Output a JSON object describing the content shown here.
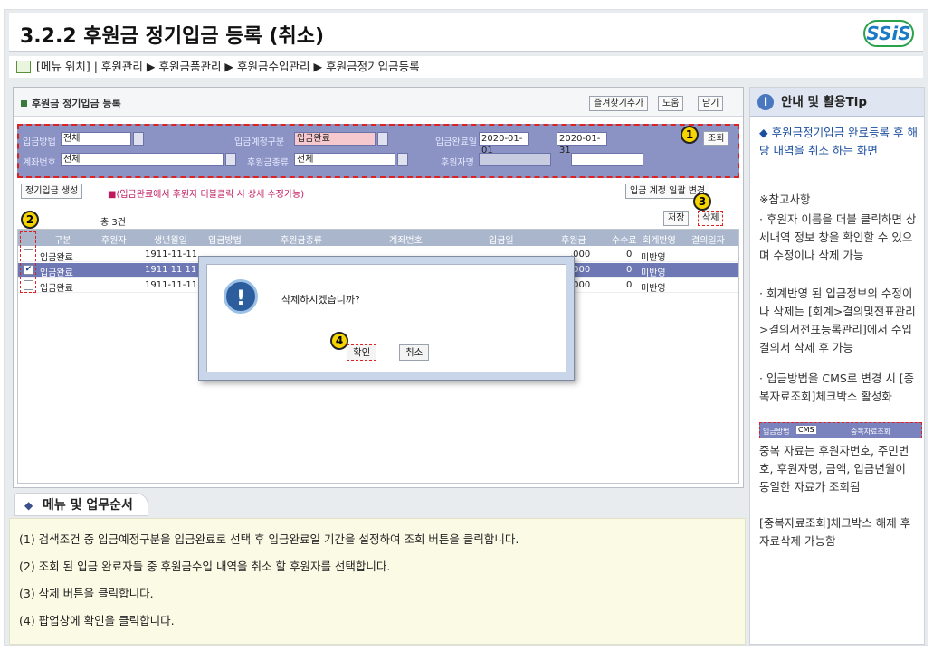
{
  "page_title": "3.2.2 후원금 정기입금 등록 (취소)",
  "logo": "SSiS",
  "breadcrumb": "[메뉴 위치] | 후원관리 ▶ 후원금품관리 ▶ 후원금수입관리 ▶ 후원금정기입금등록",
  "window": {
    "title": "후원금 정기입금 등록",
    "buttons": [
      "즐겨찾기추가",
      "도움",
      "닫기"
    ]
  },
  "search": {
    "method_label": "입금방법",
    "method_value": "전체",
    "type_label": "입금예정구분",
    "type_value": "입금완료",
    "date_label": "입금완료일",
    "date_from": "2020-01-01",
    "date_to": "2020-01-31",
    "account_label": "계좌번호",
    "account_value": "전체",
    "kind_label": "후원금종류",
    "kind_value": "전체",
    "donor_label": "후원자명",
    "search_btn": "조회"
  },
  "toolbar": {
    "create_btn": "정기입금 생성",
    "notice": "■(입금완료에서 후원자 더블클릭 시 상세 수정가능)",
    "batch_btn": "입금 계정 일괄 변경",
    "save_btn": "저장",
    "delete_btn": "삭제",
    "total": "총 3건"
  },
  "grid": {
    "headers": [
      "구분",
      "후원자",
      "생년월일",
      "입금방법",
      "후원금종류",
      "계좌번호",
      "입금일",
      "후원금",
      "수수료",
      "회계반영",
      "결의일자"
    ],
    "rows": [
      {
        "type": "입금완료",
        "birth": "1911-11-11",
        "amount": ",000",
        "fee": "0",
        "acct": "미반영",
        "checked": false
      },
      {
        "type": "입금완료",
        "birth": "1911 11 11",
        "amount": ",000",
        "fee": "0",
        "acct": "미반영",
        "checked": true
      },
      {
        "type": "입금완료",
        "birth": "1911-11-11",
        "amount": ",000",
        "fee": "0",
        "acct": "미반영",
        "checked": false
      }
    ]
  },
  "dialog": {
    "message": "삭제하시겠습니까?",
    "ok": "확인",
    "cancel": "취소"
  },
  "markers": [
    "1",
    "2",
    "3",
    "4"
  ],
  "menu": {
    "title": "메뉴 및 업무순서",
    "steps": [
      "(1) 검색조건 중 입금예정구분을 입금완료로 선택 후 입금완료일 기간을 설정하여 조회 버튼을 클릭합니다.",
      "(2) 조회 된 입금 완료자들 중 후원금수입 내역을 취소 할 후원자를 선택합니다.",
      "(3) 삭제 버튼을 클릭합니다.",
      "(4) 팝업창에 확인을 클릭합니다."
    ]
  },
  "tip": {
    "title": "안내 및 활용Tip",
    "main": "◆ 후원금정기입금 완료등록 후 해당 내역을 취소 하는 화면",
    "ref_title": "※참고사항",
    "ref1": "· 후원자 이름을 더블 클릭하면 상세내역 정보 창을 확인할 수 있으며 수정이나 삭제 가능",
    "ref2": "· 회계반영 된 입금정보의 수정이나 삭제는 [회계>결의및전표관리>결의서전표등록관리]에서 수입결의서 삭제 후 가능",
    "ref3": "· 입금방법을 CMS로 변경 시 [중복자료조회]체크박스 활성화",
    "mini_method": "입금방법",
    "mini_value": "CMS",
    "mini_check": "중복자료조회",
    "ref4": "중복 자료는 후원자번호, 주민번호, 후원자명, 금액, 입금년월이 동일한 자료가 조회됨",
    "ref5": "[중복자료조회]체크박스 해제 후 자료삭제 가능함"
  }
}
